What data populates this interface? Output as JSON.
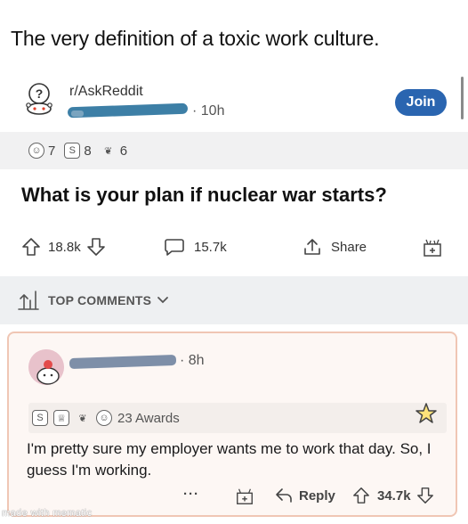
{
  "caption": "The very definition of a toxic work culture.",
  "post": {
    "subreddit": "r/AskReddit",
    "timestamp": "· 10h",
    "join_label": "Join",
    "awards": [
      {
        "icon": "helpful-award-icon",
        "count": "7"
      },
      {
        "icon": "silver-award-icon",
        "count": "8"
      },
      {
        "icon": "wholesome-award-icon",
        "count": "6"
      }
    ],
    "title": "What is your plan if nuclear war starts?",
    "upvotes": "18.8k",
    "comments": "15.7k",
    "share_label": "Share"
  },
  "top_comments_label": "TOP COMMENTS",
  "comment": {
    "timestamp": "· 8h",
    "awards_label": "23 Awards",
    "body": "I'm pretty sure my employer wants me to work that day. So, I guess I'm working.",
    "more_label": "···",
    "reply_label": "Reply",
    "upvotes": "34.7k"
  },
  "watermark": "made with mematic",
  "colors": {
    "join_button": "#2a65b0",
    "awards_bar": "#f1f1f2",
    "comment_highlight_bg": "#fdf7f4",
    "comment_highlight_border": "#f0c6b4"
  }
}
